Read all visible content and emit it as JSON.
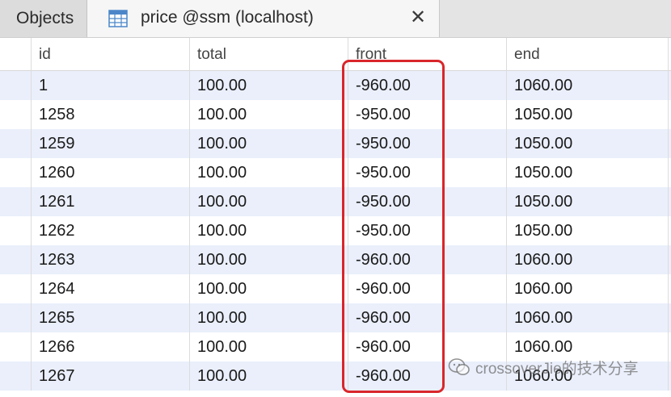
{
  "tabs": {
    "objects_label": "Objects",
    "price_label": "price @ssm (localhost)",
    "close_glyph": "✕"
  },
  "table": {
    "columns": [
      "id",
      "total",
      "front",
      "end"
    ],
    "rows": [
      {
        "id": "1",
        "total": "100.00",
        "front": "-960.00",
        "end": "1060.00"
      },
      {
        "id": "1258",
        "total": "100.00",
        "front": "-950.00",
        "end": "1050.00"
      },
      {
        "id": "1259",
        "total": "100.00",
        "front": "-950.00",
        "end": "1050.00"
      },
      {
        "id": "1260",
        "total": "100.00",
        "front": "-950.00",
        "end": "1050.00"
      },
      {
        "id": "1261",
        "total": "100.00",
        "front": "-950.00",
        "end": "1050.00"
      },
      {
        "id": "1262",
        "total": "100.00",
        "front": "-950.00",
        "end": "1050.00"
      },
      {
        "id": "1263",
        "total": "100.00",
        "front": "-960.00",
        "end": "1060.00"
      },
      {
        "id": "1264",
        "total": "100.00",
        "front": "-960.00",
        "end": "1060.00"
      },
      {
        "id": "1265",
        "total": "100.00",
        "front": "-960.00",
        "end": "1060.00"
      },
      {
        "id": "1266",
        "total": "100.00",
        "front": "-960.00",
        "end": "1060.00"
      },
      {
        "id": "1267",
        "total": "100.00",
        "front": "-960.00",
        "end": "1060.00"
      }
    ]
  },
  "watermark": {
    "text": "crossoverJie的技术分享"
  },
  "colors": {
    "highlight": "#d9262b",
    "row_stripe": "#eaeffb",
    "tabbar": "#e4e4e4"
  },
  "icons": {
    "tab_icon": "table-icon",
    "close": "close-icon",
    "watermark": "wechat-icon"
  }
}
